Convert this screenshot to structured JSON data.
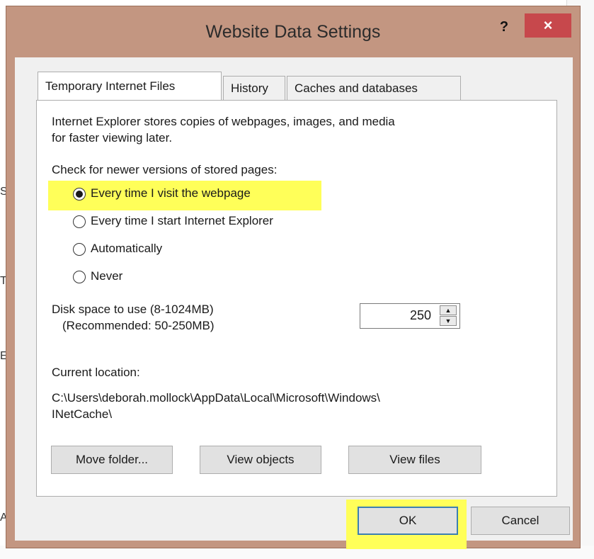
{
  "background": {
    "edge_letters": [
      "S",
      "T",
      "E",
      "A"
    ]
  },
  "window": {
    "title": "Website Data Settings",
    "help_label": "?",
    "close_label": "×"
  },
  "tabs": [
    {
      "label": "Temporary Internet Files",
      "active": true
    },
    {
      "label": "History",
      "active": false
    },
    {
      "label": "Caches and databases",
      "active": false
    }
  ],
  "panel": {
    "description_line1": "Internet Explorer stores copies of webpages, images, and media",
    "description_line2": "for faster viewing later.",
    "check_label": "Check for newer versions of stored pages:",
    "radio_options": [
      {
        "label": "Every time I visit the webpage",
        "checked": true
      },
      {
        "label": "Every time I start Internet Explorer",
        "checked": false
      },
      {
        "label": "Automatically",
        "checked": false
      },
      {
        "label": "Never",
        "checked": false
      }
    ],
    "disk_label_line1": "Disk space to use (8-1024MB)",
    "disk_label_line2": "(Recommended: 50-250MB)",
    "disk_value": "250",
    "location_label": "Current location:",
    "location_path_line1": "C:\\Users\\deborah.mollock\\AppData\\Local\\Microsoft\\Windows\\",
    "location_path_line2": "INetCache\\",
    "buttons": {
      "move_folder": "Move folder...",
      "view_objects": "View objects",
      "view_files": "View files"
    }
  },
  "footer": {
    "ok": "OK",
    "cancel": "Cancel"
  },
  "colors": {
    "highlight": "#ffff59",
    "frame": "#c39681",
    "close_button": "#c7484c"
  }
}
